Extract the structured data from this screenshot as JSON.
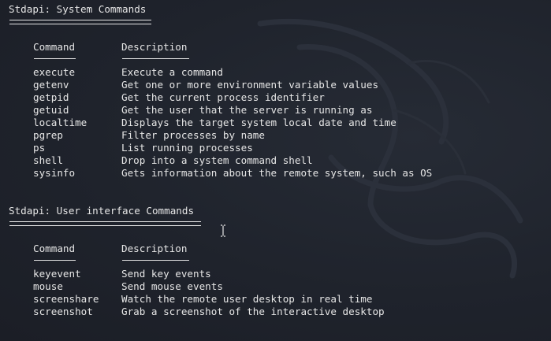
{
  "sections": [
    {
      "title": "Stdapi: System Commands",
      "header": {
        "command": "Command",
        "description": "Description"
      },
      "rows": [
        {
          "command": "execute",
          "description": "Execute a command"
        },
        {
          "command": "getenv",
          "description": "Get one or more environment variable values"
        },
        {
          "command": "getpid",
          "description": "Get the current process identifier"
        },
        {
          "command": "getuid",
          "description": "Get the user that the server is running as"
        },
        {
          "command": "localtime",
          "description": "Displays the target system local date and time"
        },
        {
          "command": "pgrep",
          "description": "Filter processes by name"
        },
        {
          "command": "ps",
          "description": "List running processes"
        },
        {
          "command": "shell",
          "description": "Drop into a system command shell"
        },
        {
          "command": "sysinfo",
          "description": "Gets information about the remote system, such as OS"
        }
      ]
    },
    {
      "title": "Stdapi: User interface Commands",
      "header": {
        "command": "Command",
        "description": "Description"
      },
      "rows": [
        {
          "command": "keyevent",
          "description": "Send key events"
        },
        {
          "command": "mouse",
          "description": "Send mouse events"
        },
        {
          "command": "screenshare",
          "description": "Watch the remote user desktop in real time"
        },
        {
          "command": "screenshot",
          "description": "Grab a screenshot of the interactive desktop"
        }
      ]
    }
  ],
  "colors": {
    "background": "#1e222b",
    "text": "#e6e6e6"
  },
  "icons": {
    "background_logo": "kali-dragon-icon",
    "cursor": "text-cursor-icon"
  }
}
